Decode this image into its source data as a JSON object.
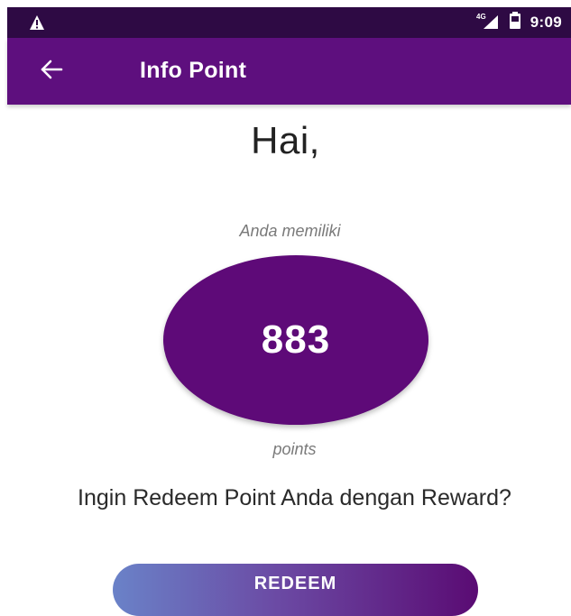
{
  "status_bar": {
    "time": "9:09",
    "network": "4G",
    "left_icon": "warning-icon",
    "signal_icon": "signal-icon",
    "battery_icon": "battery-icon"
  },
  "app_bar": {
    "title": "Info Point",
    "back_icon": "back-arrow-icon"
  },
  "main": {
    "greeting": "Hai,",
    "subtitle": "Anda memiliki",
    "points_value": "883",
    "points_unit": "points",
    "redeem_question": "Ingin Redeem Point Anda dengan Reward?",
    "redeem_button_label": "REDEEM"
  },
  "colors": {
    "status_bar": "#2e0a44",
    "app_bar": "#5e0f7e",
    "circle": "#5e0a78",
    "button_gradient_start": "#6a82c8",
    "button_gradient_end": "#5a0b73"
  }
}
